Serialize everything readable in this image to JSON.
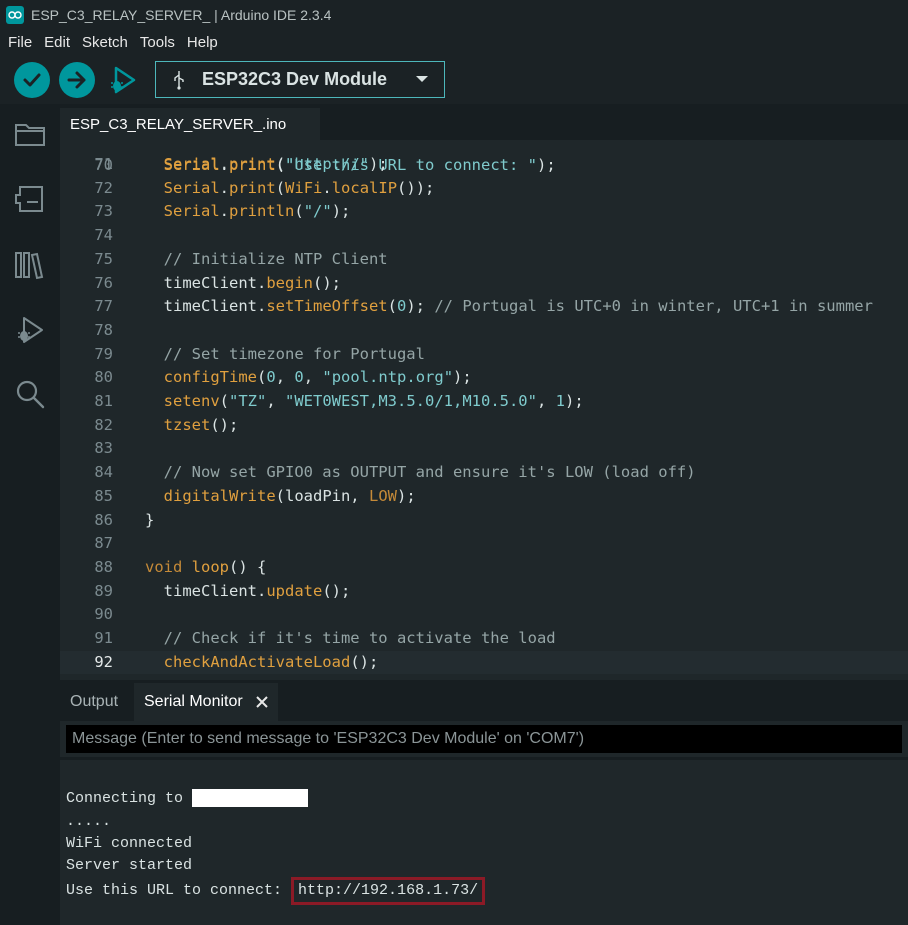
{
  "window": {
    "title": "ESP_C3_RELAY_SERVER_ | Arduino IDE 2.3.4"
  },
  "menu": [
    "File",
    "Edit",
    "Sketch",
    "Tools",
    "Help"
  ],
  "toolbar": {
    "board": "ESP32C3 Dev Module"
  },
  "tab": {
    "filename": "ESP_C3_RELAY_SERVER_.ino"
  },
  "code": {
    "current_line": "92",
    "lines": [
      {
        "n": "71",
        "t": "  Serial.print(\"http://\");"
      },
      {
        "n": "72",
        "t": "  Serial.print(WiFi.localIP());"
      },
      {
        "n": "73",
        "t": "  Serial.println(\"/\");"
      },
      {
        "n": "74",
        "t": ""
      },
      {
        "n": "75",
        "t": "  // Initialize NTP Client"
      },
      {
        "n": "76",
        "t": "  timeClient.begin();"
      },
      {
        "n": "77",
        "t": "  timeClient.setTimeOffset(0); // Portugal is UTC+0 in winter, UTC+1 in summer"
      },
      {
        "n": "78",
        "t": ""
      },
      {
        "n": "79",
        "t": "  // Set timezone for Portugal"
      },
      {
        "n": "80",
        "t": "  configTime(0, 0, \"pool.ntp.org\");"
      },
      {
        "n": "81",
        "t": "  setenv(\"TZ\", \"WET0WEST,M3.5.0/1,M10.5.0\", 1);"
      },
      {
        "n": "82",
        "t": "  tzset();"
      },
      {
        "n": "83",
        "t": ""
      },
      {
        "n": "84",
        "t": "  // Now set GPIO0 as OUTPUT and ensure it's LOW (load off)"
      },
      {
        "n": "85",
        "t": "  digitalWrite(loadPin, LOW);"
      },
      {
        "n": "86",
        "t": "}"
      },
      {
        "n": "87",
        "t": ""
      },
      {
        "n": "88",
        "t": "void loop() {"
      },
      {
        "n": "89",
        "t": "  timeClient.update();"
      },
      {
        "n": "90",
        "t": ""
      },
      {
        "n": "91",
        "t": "  // Check if it's time to activate the load"
      },
      {
        "n": "92",
        "t": "  checkAndActivateLoad();"
      }
    ]
  },
  "panel": {
    "tab_output": "Output",
    "tab_serial": "Serial Monitor",
    "message_placeholder": "Message (Enter to send message to 'ESP32C3 Dev Module' on 'COM7')"
  },
  "serial": {
    "connecting": "Connecting to ",
    "dots": ".....",
    "wifi": "WiFi connected",
    "server": "Server started",
    "url_label": "Use this URL to connect: ",
    "url": "http://192.168.1.73/"
  },
  "colors": {
    "accent": "#00979d",
    "highlight_box": "#8b1a26"
  }
}
